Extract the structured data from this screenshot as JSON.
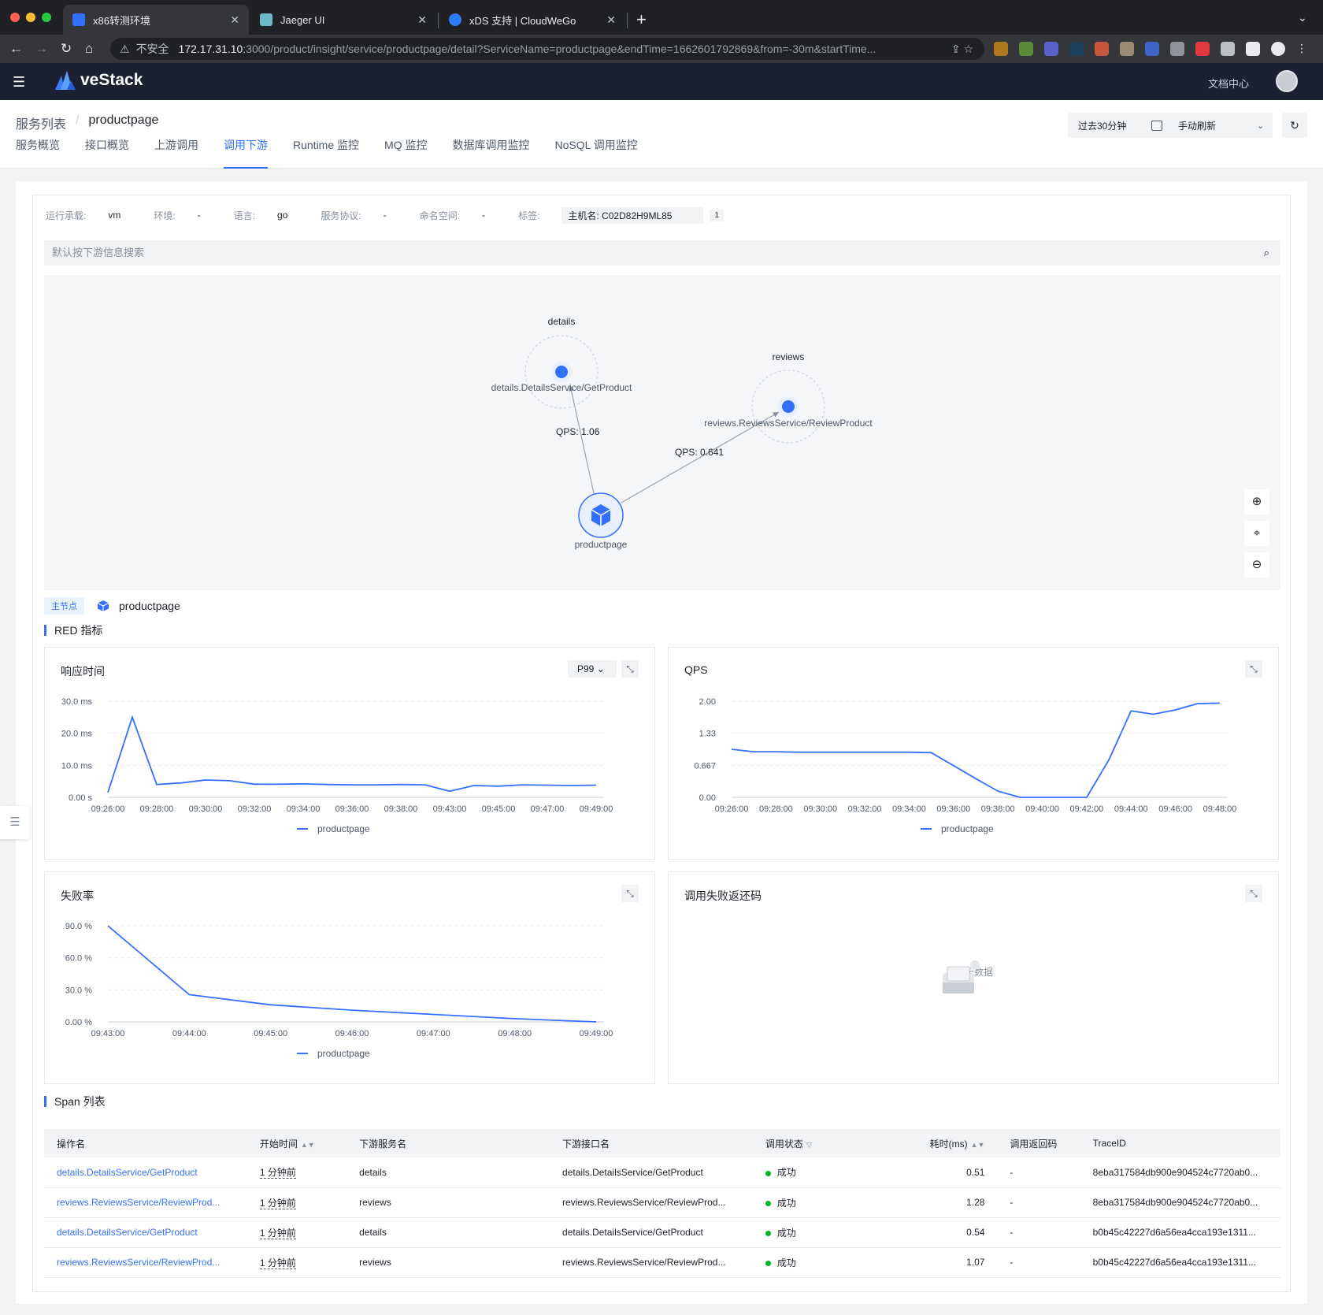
{
  "browser": {
    "tabs": [
      {
        "title": "x86转测环境",
        "icon_color": "#3370ff",
        "active": true
      },
      {
        "title": "Jaeger UI",
        "icon_color": "#6fb6c9",
        "active": false
      },
      {
        "title": "xDS 支持 | CloudWeGo",
        "icon_color": "#2e7df6",
        "active": false
      }
    ],
    "insecure_label": "不安全",
    "url_host": "172.17.31.10",
    "url_rest": ":3000/product/insight/service/productpage/detail?ServiceName=productpage&endTime=1662601792869&from=-30m&startTime..."
  },
  "app": {
    "brand": "veStack",
    "doc_center": "文档中心"
  },
  "breadcrumb": {
    "root": "服务列表",
    "sep": "/",
    "current": "productpage"
  },
  "time_range": {
    "range": "过去30分钟",
    "refresh": "手动刷新"
  },
  "tabs": [
    "服务概览",
    "接口概览",
    "上游调用",
    "调用下游",
    "Runtime 监控",
    "MQ 监控",
    "数据库调用监控",
    "NoSQL 调用监控"
  ],
  "active_tab": "调用下游",
  "meta": {
    "runtime_label": "运行承载:",
    "runtime": "vm",
    "env_label": "环境:",
    "env": "-",
    "lang_label": "语言:",
    "lang": "go",
    "protocol_label": "服务协议:",
    "protocol": "-",
    "namespace_label": "命名空间:",
    "namespace": "-",
    "tags_label": "标签:",
    "tag": "主机名: C02D82H9ML85",
    "tag_count": "1"
  },
  "search": {
    "placeholder": "默认按下游信息搜索"
  },
  "topology": {
    "nodes": [
      {
        "group": "details",
        "endpoint": "details.DetailsService/GetProduct"
      },
      {
        "group": "reviews",
        "endpoint": "reviews.ReviewsService/ReviewProduct"
      },
      {
        "group": "",
        "endpoint": "productpage"
      }
    ],
    "edges": [
      {
        "label": "QPS: 1.06"
      },
      {
        "label": "QPS: 0.641"
      }
    ]
  },
  "main_node": {
    "tag": "主节点",
    "name": "productpage"
  },
  "red_title": "RED 指标",
  "charts": {
    "latency": {
      "title": "响应时间",
      "percentile": "P99"
    },
    "qps": {
      "title": "QPS"
    },
    "error": {
      "title": "失败率"
    },
    "codes": {
      "title": "调用失败返还码",
      "empty": "暂无数据"
    }
  },
  "chart_data": [
    {
      "type": "line",
      "title": "响应时间",
      "yticks": [
        "0.00 s",
        "10.0 ms",
        "20.0 ms",
        "30.0 ms"
      ],
      "ylim": [
        0,
        30
      ],
      "x": [
        "09:26:00",
        "09:27:00",
        "09:28:00",
        "09:29:00",
        "09:30:00",
        "09:31:00",
        "09:32:00",
        "09:33:00",
        "09:34:00",
        "09:35:00",
        "09:36:00",
        "09:37:00",
        "09:38:00",
        "09:39:00",
        "09:43:00",
        "09:44:00",
        "09:45:00",
        "09:46:00",
        "09:47:00",
        "09:48:00",
        "09:49:00"
      ],
      "xticks": [
        "09:26:00",
        "09:28:00",
        "09:30:00",
        "09:32:00",
        "09:34:00",
        "09:36:00",
        "09:38:00",
        "09:43:00",
        "09:45:00",
        "09:47:00",
        "09:49:00"
      ],
      "series": [
        {
          "name": "productpage",
          "color": "#3370ff",
          "values": [
            1.5,
            25.0,
            4.0,
            4.5,
            5.4,
            5.2,
            4.1,
            4.1,
            4.2,
            4.0,
            3.9,
            3.9,
            4.0,
            3.9,
            1.9,
            3.7,
            3.5,
            3.9,
            3.8,
            3.7,
            3.8
          ]
        }
      ]
    },
    {
      "type": "line",
      "title": "QPS",
      "yticks": [
        "0.00",
        "0.667",
        "1.33",
        "2.00"
      ],
      "ylim": [
        0,
        2
      ],
      "x": [
        "09:26:00",
        "09:27:00",
        "09:28:00",
        "09:29:00",
        "09:30:00",
        "09:31:00",
        "09:32:00",
        "09:33:00",
        "09:34:00",
        "09:35:00",
        "09:36:00",
        "09:37:00",
        "09:38:00",
        "09:39:00",
        "09:40:00",
        "09:41:00",
        "09:42:00",
        "09:43:00",
        "09:44:00",
        "09:45:00",
        "09:46:00",
        "09:47:00",
        "09:48:00"
      ],
      "xticks": [
        "09:26:00",
        "09:28:00",
        "09:30:00",
        "09:32:00",
        "09:34:00",
        "09:36:00",
        "09:38:00",
        "09:40:00",
        "09:42:00",
        "09:44:00",
        "09:46:00",
        "09:48:00"
      ],
      "series": [
        {
          "name": "productpage",
          "color": "#3370ff",
          "values": [
            1.0,
            0.95,
            0.95,
            0.94,
            0.94,
            0.94,
            0.94,
            0.94,
            0.94,
            0.93,
            0.66,
            0.39,
            0.13,
            0.0,
            0.0,
            0.0,
            0.0,
            0.78,
            1.8,
            1.73,
            1.82,
            1.95,
            1.96
          ]
        }
      ]
    },
    {
      "type": "line",
      "title": "失败率",
      "yticks": [
        "0.00 %",
        "30.0 %",
        "60.0 %",
        "90.0 %"
      ],
      "ylim": [
        0,
        90
      ],
      "x": [
        "09:43:00",
        "09:44:00",
        "09:45:00",
        "09:46:00",
        "09:47:00",
        "09:48:00",
        "09:49:00"
      ],
      "xticks": [
        "09:43:00",
        "09:44:00",
        "09:45:00",
        "09:46:00",
        "09:47:00",
        "09:48:00",
        "09:49:00"
      ],
      "series": [
        {
          "name": "productpage",
          "color": "#3370ff",
          "values": [
            90.0,
            25.5,
            16.0,
            11.0,
            7.0,
            3.0,
            0.0
          ]
        }
      ]
    }
  ],
  "span_title": "Span 列表",
  "span_table": {
    "columns": [
      "操作名",
      "开始时间",
      "下游服务名",
      "下游接口名",
      "调用状态",
      "耗时(ms)",
      "调用返回码",
      "TraceID"
    ],
    "rows": [
      [
        "details.DetailsService/GetProduct",
        "1 分钟前",
        "details",
        "details.DetailsService/GetProduct",
        "成功",
        "0.51",
        "-",
        "8eba317584db900e904524c7720ab0..."
      ],
      [
        "reviews.ReviewsService/ReviewProd...",
        "1 分钟前",
        "reviews",
        "reviews.ReviewsService/ReviewProd...",
        "成功",
        "1.28",
        "-",
        "8eba317584db900e904524c7720ab0..."
      ],
      [
        "details.DetailsService/GetProduct",
        "1 分钟前",
        "details",
        "details.DetailsService/GetProduct",
        "成功",
        "0.54",
        "-",
        "b0b45c42227d6a56ea4cca193e1311..."
      ],
      [
        "reviews.ReviewsService/ReviewProd...",
        "1 分钟前",
        "reviews",
        "reviews.ReviewsService/ReviewProd...",
        "成功",
        "1.07",
        "-",
        "b0b45c42227d6a56ea4cca193e1311..."
      ]
    ]
  }
}
